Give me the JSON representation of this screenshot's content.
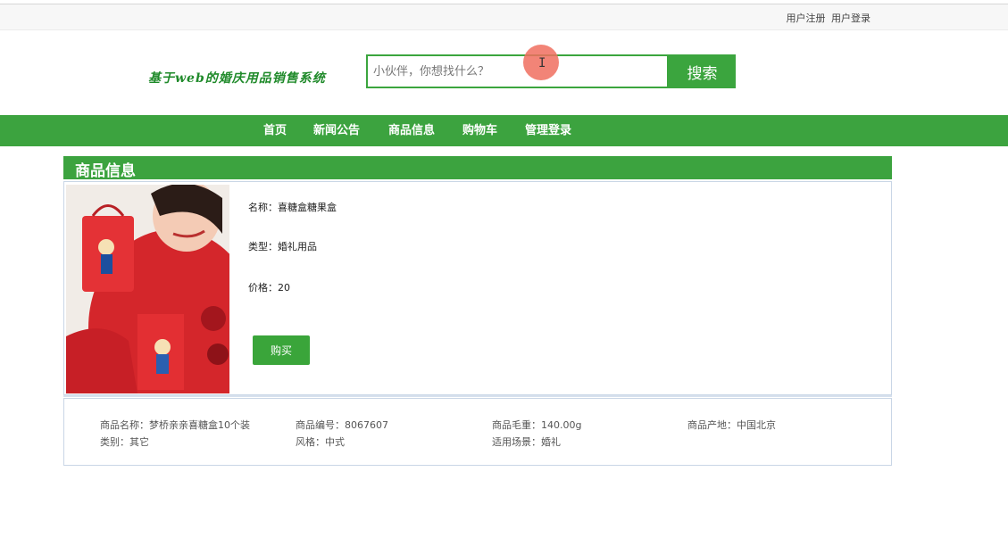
{
  "topbar": {
    "register": "用户注册",
    "login": "用户登录"
  },
  "site": {
    "title": "基于web的婚庆用品销售系统"
  },
  "search": {
    "placeholder": "小伙伴，你想找什么？",
    "button": "搜索"
  },
  "nav": {
    "items": [
      "首页",
      "新闻公告",
      "商品信息",
      "购物车",
      "管理登录"
    ]
  },
  "panel": {
    "title": "商品信息"
  },
  "product": {
    "name": "名称：喜糖盒糖果盒",
    "type": "类型：婚礼用品",
    "price": "价格：20",
    "buy": "购买"
  },
  "specs": {
    "row1": [
      "商品名称：梦桥亲亲喜糖盒10个装",
      "商品编号：8067607",
      "商品毛重：140.00g",
      "商品产地：中国北京"
    ],
    "row2": [
      "类别：其它",
      "风格：中式",
      "适用场景：婚礼"
    ]
  },
  "colors": {
    "brand_green": "#3ca33f",
    "title_green": "#1f8a2a",
    "border": "#c9d6e6"
  }
}
